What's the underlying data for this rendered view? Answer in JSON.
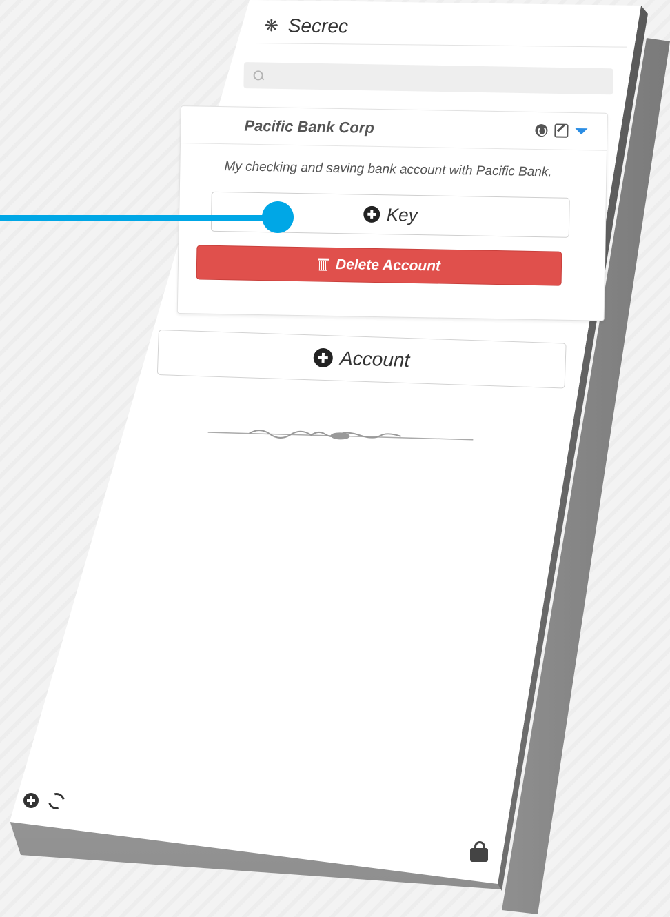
{
  "app": {
    "title": "Secrec",
    "logo_icon": "flower-icon"
  },
  "search": {
    "placeholder": "",
    "icon": "search-icon"
  },
  "account": {
    "name": "Pacific Bank Corp",
    "description": "My checking and saving bank account with Pacific Bank.",
    "tools": [
      "globe-icon",
      "edit-icon",
      "caret-down-icon"
    ],
    "add_key_label": "Key",
    "delete_label": "Delete Account"
  },
  "add_account_label": "Account",
  "footer": {
    "icons": [
      "plus-circle-icon",
      "refresh-icon",
      "lock-icon"
    ]
  },
  "colors": {
    "danger": "#e0504c",
    "accent": "#2a8de4",
    "pointer": "#00a7e6"
  }
}
